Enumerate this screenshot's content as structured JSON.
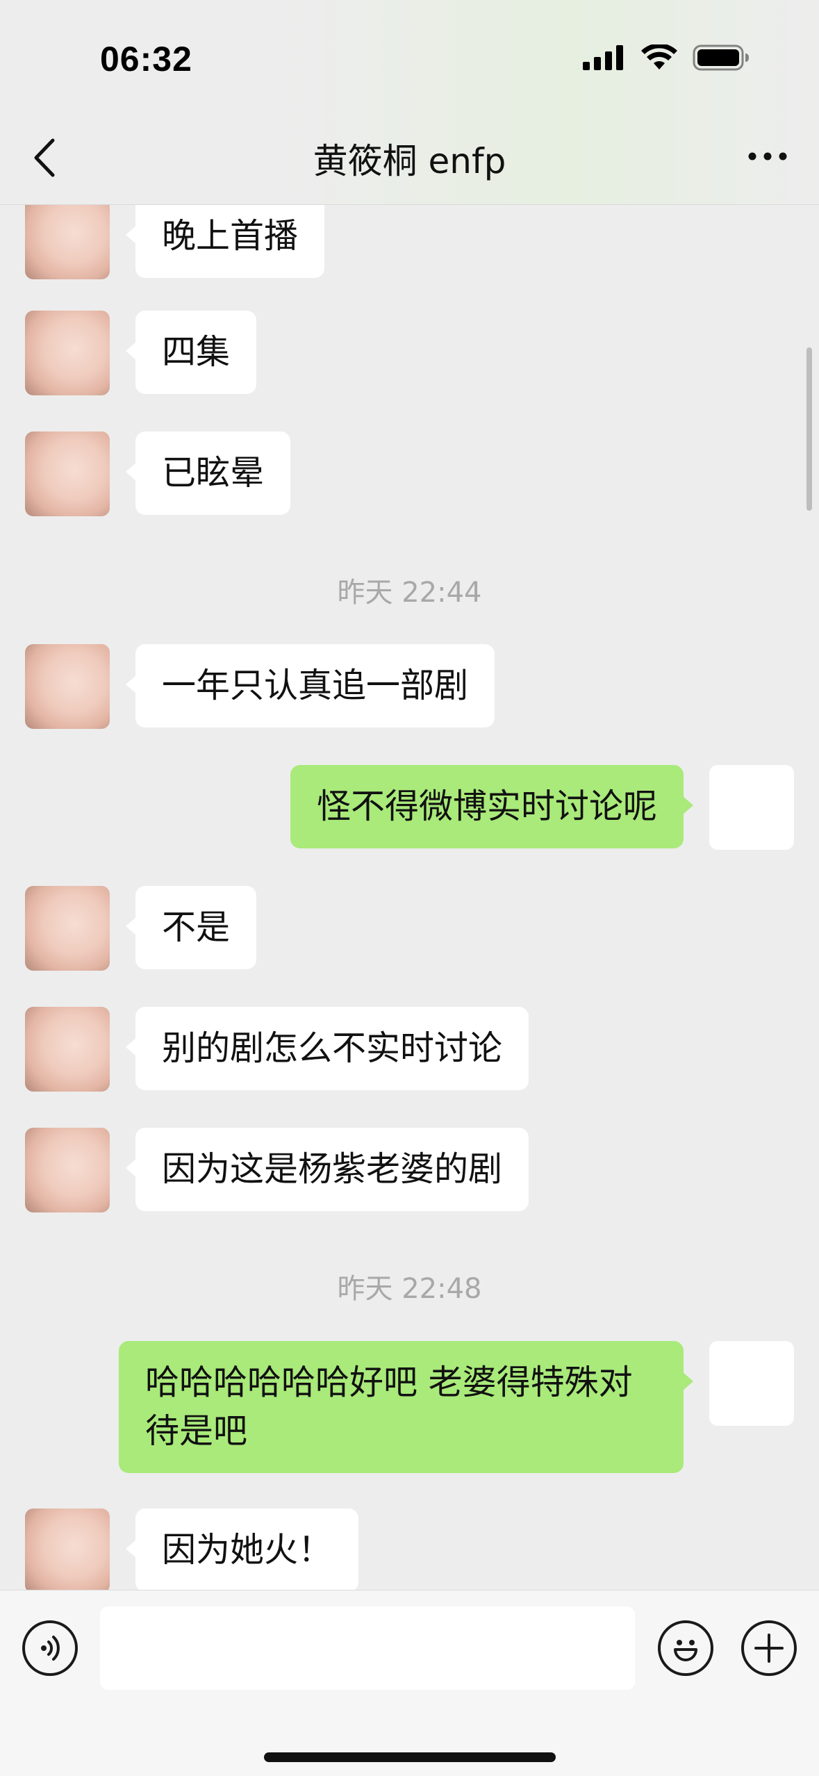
{
  "status_bar": {
    "time": "06:32"
  },
  "header": {
    "title": "黄筱桐 enfp"
  },
  "messages": [
    {
      "type": "in",
      "text": "晚上首播"
    },
    {
      "type": "in",
      "text": "四集"
    },
    {
      "type": "in",
      "text": "已眩晕"
    },
    {
      "type": "time",
      "text": "昨天 22:44"
    },
    {
      "type": "in",
      "text": "一年只认真追一部剧"
    },
    {
      "type": "out",
      "text": "怪不得微博实时讨论呢"
    },
    {
      "type": "in",
      "text": "不是"
    },
    {
      "type": "in",
      "text": "别的剧怎么不实时讨论"
    },
    {
      "type": "in",
      "text": "因为这是杨紫老婆的剧"
    },
    {
      "type": "time",
      "text": "昨天 22:48"
    },
    {
      "type": "out",
      "text": "哈哈哈哈哈哈好吧 老婆得特殊对\n待是吧"
    },
    {
      "type": "in",
      "text": "因为她火！"
    }
  ],
  "input": {
    "value": ""
  },
  "colors": {
    "outgoing_bubble": "#a9ea7a",
    "incoming_bubble": "#ffffff",
    "background": "#ededed"
  }
}
